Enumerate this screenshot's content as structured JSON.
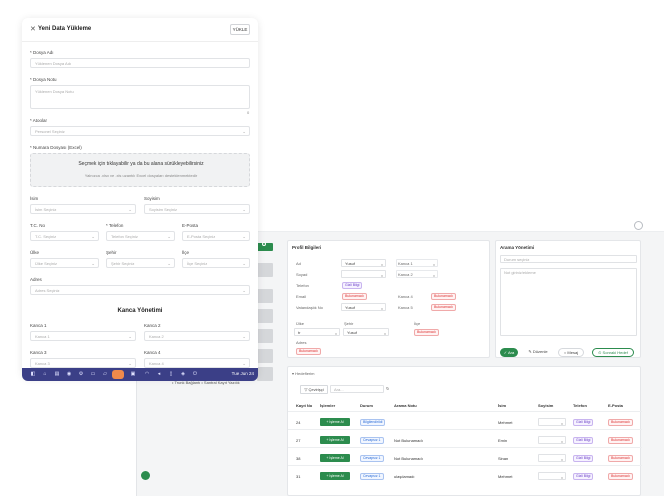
{
  "modal": {
    "title": "Yeni Data Yükleme",
    "upload_button": "YÜKLE",
    "file_name_label": "* Dosya Adı",
    "file_name_placeholder": "Yüklenen Dosya Adı",
    "file_note_label": "* Dosya Notu",
    "file_note_placeholder": "Yüklenen Dosya Notu",
    "file_note_count": "0",
    "assignees_label": "* Atoolar",
    "assignees_placeholder": "Personel Seçiniz",
    "number_file_label": "* Numara Dosyası (Excel)",
    "dropzone_main": "Seçmek için tıklayabilir ya da bu alana sürükleyebilirsiniz",
    "dropzone_sub": "Yalnızca .xlsx ve .xls uzantılı Excel dosyaları desteklenmektedir",
    "name_label": "İsim",
    "name_placeholder": "İsim Seçiniz",
    "surname_label": "Soyisim",
    "surname_placeholder": "Soyisim Seçiniz",
    "tc_label": "T.C. No",
    "tc_placeholder": "T.C. Seçiniz",
    "phone_label": "* Telefon",
    "phone_placeholder": "Telefon Seçiniz",
    "email_label": "E-Posta",
    "email_placeholder": "E-Posta Seçiniz",
    "country_label": "Ülke",
    "country_placeholder": "Ülke Seçiniz",
    "city_label": "Şehir",
    "city_placeholder": "Şehir Seçiniz",
    "district_label": "İlçe",
    "district_placeholder": "İlçe Seçiniz",
    "address_label": "Adres",
    "address_placeholder": "Adres Seçiniz",
    "channel_section_title": "Kanca Yönetimi",
    "channel1_label": "Kanca 1",
    "channel1_placeholder": "Kanca 1",
    "channel2_label": "Kanca 2",
    "channel2_placeholder": "Kanca 2",
    "channel3_label": "Kanca 3",
    "channel3_placeholder": "Kanca 3",
    "channel4_label": "Kanca 4",
    "channel4_placeholder": "Kanca 4"
  },
  "taskbar": {
    "time": "Tue Jun 24",
    "icons": [
      "launcher-icon",
      "home-icon",
      "files-icon",
      "browser-icon",
      "settings-icon",
      "terminal-icon",
      "folder-icon",
      "music-icon",
      "store-icon",
      "wifi-icon",
      "volume-icon",
      "battery-icon",
      "network-icon",
      "power-icon"
    ]
  },
  "breadcrumb": "• Trunk Bağlantı  • Santral Kayıt Yazılık",
  "crm": {
    "profile_title": "Profil Bilgileri",
    "call_title": "Arama Yönetimi",
    "fields": [
      {
        "label": "Ad",
        "value": "Yusuf"
      },
      {
        "label": "Soyad",
        "value": ""
      },
      {
        "label": "Telefon",
        "value": "Gizli Bilgi"
      },
      {
        "label": "Email",
        "value": "Bulunamadı"
      },
      {
        "label": "Vatandaşlık No",
        "value": "Yusuf"
      }
    ],
    "channels": [
      {
        "label": "Kanca 1",
        "value": ""
      },
      {
        "label": "Kanca 2",
        "value": ""
      },
      {
        "label": "Kanca 4",
        "value": "Bulunamadı"
      },
      {
        "label": "Kanca 5",
        "value": "Bulunamadı"
      }
    ],
    "location_headers": [
      "Ülke",
      "Şehir",
      "İlçe"
    ],
    "location_values": [
      "tr",
      "Yusuf",
      "Bulunamadı"
    ],
    "address_label": "Adres",
    "address_value": "Bulunamadı",
    "call_status_placeholder": "Durum seçiniz",
    "call_note_placeholder": "Not giriniz/ekleme",
    "buttons": {
      "call": "Ara",
      "edit": "Düzenle",
      "message": "Mesaj",
      "next": "Sonraki Hedef"
    },
    "targets_title": "Hedeflerim",
    "filter_button": "Çevirişçi",
    "filter_placeholder": "Ara...",
    "table_headers": [
      "Kayıt No",
      "İşlemler",
      "Durum",
      "Arama Notu",
      "İsim",
      "Soyisim",
      "Telefon",
      "E-Posta"
    ],
    "action_label": "İşleme Al",
    "rows": [
      {
        "id": "24",
        "status": "Bilgilendirildi",
        "note": "",
        "name": "Mehmet",
        "surname": "",
        "phone": "Gizli Bilgi",
        "email": "Bulunamadı"
      },
      {
        "id": "27",
        "status": "Cevapsız 1",
        "note": "Not Bulunamadı",
        "name": "Emin",
        "surname": "",
        "phone": "Gizli Bilgi",
        "email": "Bulunamadı"
      },
      {
        "id": "38",
        "status": "Cevapsız 1",
        "note": "Not Bulunamadı",
        "name": "Sinan",
        "surname": "",
        "phone": "Gizli Bilgi",
        "email": "Bulunamadı"
      },
      {
        "id": "31",
        "status": "Cevapsız 1",
        "note": "ulaşılamadı",
        "name": "Mehmet",
        "surname": "",
        "phone": "Gizli Bilgi",
        "email": "Bulunamadı"
      }
    ]
  }
}
